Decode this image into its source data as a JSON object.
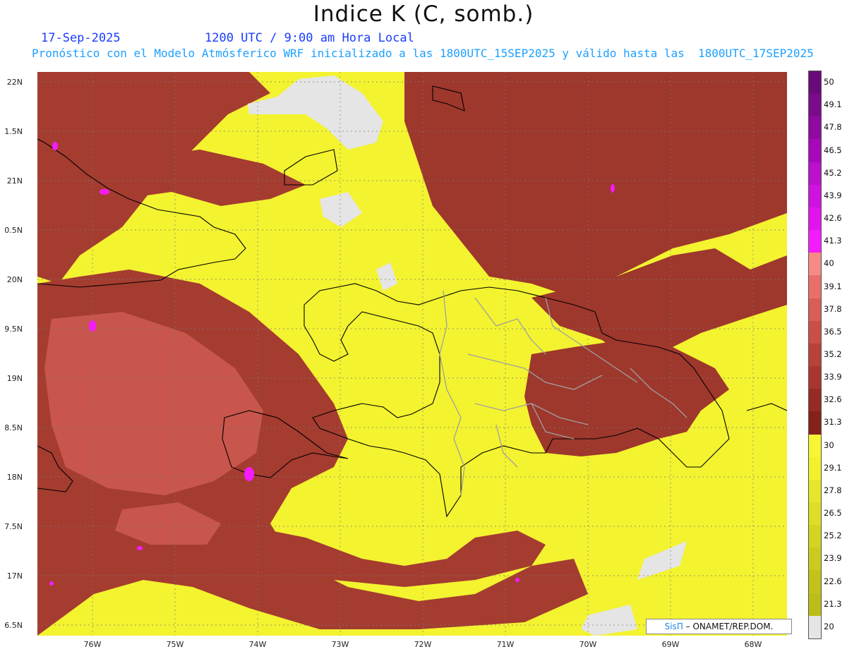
{
  "title": "Indice K (C, somb.)",
  "date_label": "17-Sep-2025",
  "time_label": "1200 UTC / 9:00 am Hora Local",
  "description": "Pronóstico con el Modelo Atmósferico WRF inicializado a las 1800UTC_15SEP2025 y válido hasta las  1800UTC_17SEP2025",
  "lat_labels": [
    "22N",
    "1.5N",
    "21N",
    "0.5N",
    "20N",
    "9.5N",
    "19N",
    "8.5N",
    "18N",
    "7.5N",
    "17N",
    "6.5N"
  ],
  "lon_labels": [
    "76W",
    "75W",
    "74W",
    "73W",
    "72W",
    "71W",
    "70W",
    "69W",
    "68W"
  ],
  "colorbar": {
    "labels": [
      "50",
      "49.1",
      "47.8",
      "46.5",
      "45.2",
      "43.9",
      "42.6",
      "41.3",
      "40",
      "39.1",
      "37.8",
      "36.5",
      "35.2",
      "33.9",
      "32.6",
      "31.3",
      "30",
      "29.1",
      "27.8",
      "26.5",
      "25.2",
      "23.9",
      "22.6",
      "21.3",
      "20"
    ],
    "colors": [
      "#6a0a7a",
      "#7c0a8c",
      "#900aa2",
      "#a60ab8",
      "#bb10cc",
      "#cf12de",
      "#e214ee",
      "#f51bff",
      "#f78a86",
      "#e9706a",
      "#d85e57",
      "#c94f47",
      "#b8413a",
      "#a8362f",
      "#952b23",
      "#842219",
      "#f6f634",
      "#f1f12e",
      "#e6e62a",
      "#dede26",
      "#d4d422",
      "#cbcb1e",
      "#c2c21a",
      "#bdbd18",
      "#e5e5e5"
    ]
  },
  "credit": {
    "brand": "SisΠ",
    "org": "– ONAMET/REP.DOM."
  }
}
